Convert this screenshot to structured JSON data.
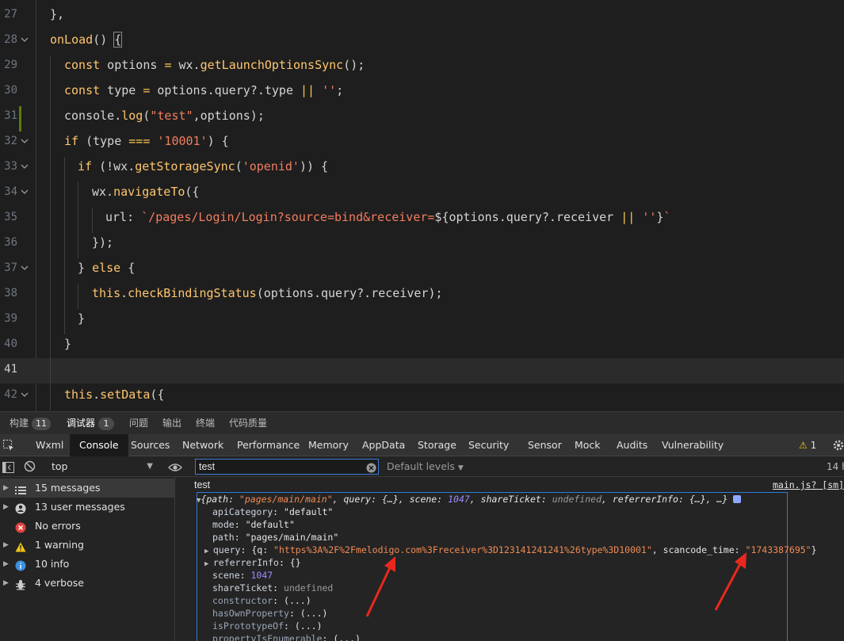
{
  "editor": {
    "lines": [
      {
        "num": "27",
        "fold": false,
        "tokens": [
          {
            "t": "},",
            "c": "pl"
          }
        ]
      },
      {
        "num": "28",
        "fold": true,
        "tokens": [
          {
            "t": "onLoad",
            "c": "fn"
          },
          {
            "t": "() ",
            "c": "pl"
          },
          {
            "t": "{",
            "c": "pl"
          }
        ]
      },
      {
        "num": "29",
        "fold": false,
        "tokens": [
          {
            "t": "const",
            "c": "kw"
          },
          {
            "t": " options ",
            "c": "pl"
          },
          {
            "t": "=",
            "c": "op"
          },
          {
            "t": " wx.",
            "c": "pl"
          },
          {
            "t": "getLaunchOptionsSync",
            "c": "fn"
          },
          {
            "t": "();",
            "c": "pl"
          }
        ]
      },
      {
        "num": "30",
        "fold": false,
        "tokens": [
          {
            "t": "const",
            "c": "kw"
          },
          {
            "t": " type ",
            "c": "pl"
          },
          {
            "t": "=",
            "c": "op"
          },
          {
            "t": " options.query?.type ",
            "c": "pl"
          },
          {
            "t": "||",
            "c": "op"
          },
          {
            "t": " ",
            "c": "pl"
          },
          {
            "t": "''",
            "c": "str"
          },
          {
            "t": ";",
            "c": "pl"
          }
        ]
      },
      {
        "num": "31",
        "fold": false,
        "tokens": [
          {
            "t": "console.",
            "c": "pl"
          },
          {
            "t": "log",
            "c": "fn"
          },
          {
            "t": "(",
            "c": "pl"
          },
          {
            "t": "\"test\"",
            "c": "str"
          },
          {
            "t": ",options);",
            "c": "pl"
          }
        ]
      },
      {
        "num": "32",
        "fold": true,
        "tokens": [
          {
            "t": "if",
            "c": "kw"
          },
          {
            "t": " (type ",
            "c": "pl"
          },
          {
            "t": "===",
            "c": "op"
          },
          {
            "t": " ",
            "c": "pl"
          },
          {
            "t": "'10001'",
            "c": "str"
          },
          {
            "t": ") {",
            "c": "pl"
          }
        ]
      },
      {
        "num": "33",
        "fold": true,
        "tokens": [
          {
            "t": "if",
            "c": "kw"
          },
          {
            "t": " (!wx.",
            "c": "pl"
          },
          {
            "t": "getStorageSync",
            "c": "fn"
          },
          {
            "t": "(",
            "c": "pl"
          },
          {
            "t": "'openid'",
            "c": "str"
          },
          {
            "t": ")) {",
            "c": "pl"
          }
        ]
      },
      {
        "num": "34",
        "fold": true,
        "tokens": [
          {
            "t": "wx.",
            "c": "pl"
          },
          {
            "t": "navigateTo",
            "c": "fn"
          },
          {
            "t": "({",
            "c": "pl"
          }
        ]
      },
      {
        "num": "35",
        "fold": false,
        "tokens": [
          {
            "t": "url: ",
            "c": "pl"
          },
          {
            "t": "`/pages/Login/Login?source=bind&receiver=",
            "c": "str"
          },
          {
            "t": "${options.query?.receiver ",
            "c": "pl"
          },
          {
            "t": "||",
            "c": "op"
          },
          {
            "t": " ",
            "c": "pl"
          },
          {
            "t": "''",
            "c": "str"
          },
          {
            "t": "}",
            "c": "pl"
          },
          {
            "t": "`",
            "c": "str"
          }
        ]
      },
      {
        "num": "36",
        "fold": false,
        "tokens": [
          {
            "t": "});",
            "c": "pl"
          }
        ]
      },
      {
        "num": "37",
        "fold": true,
        "tokens": [
          {
            "t": "} ",
            "c": "pl"
          },
          {
            "t": "else",
            "c": "kw"
          },
          {
            "t": " {",
            "c": "pl"
          }
        ]
      },
      {
        "num": "38",
        "fold": false,
        "tokens": [
          {
            "t": "this",
            "c": "kw"
          },
          {
            "t": ".",
            "c": "pl"
          },
          {
            "t": "checkBindingStatus",
            "c": "fn"
          },
          {
            "t": "(options.query?.receiver);",
            "c": "pl"
          }
        ]
      },
      {
        "num": "39",
        "fold": false,
        "tokens": [
          {
            "t": "}",
            "c": "pl"
          }
        ]
      },
      {
        "num": "40",
        "fold": false,
        "tokens": [
          {
            "t": "}",
            "c": "pl"
          }
        ]
      },
      {
        "num": "41",
        "fold": false,
        "tokens": []
      },
      {
        "num": "42",
        "fold": true,
        "tokens": [
          {
            "t": "this",
            "c": "kw"
          },
          {
            "t": ".",
            "c": "pl"
          },
          {
            "t": "setData",
            "c": "fn"
          },
          {
            "t": "({",
            "c": "pl"
          }
        ]
      }
    ]
  },
  "panel_tabs": {
    "build_label": "构建",
    "build_count": "11",
    "debugger_label": "调试器",
    "debugger_count": "1",
    "problems_label": "问题",
    "output_label": "输出",
    "terminal_label": "终端",
    "code_quality_label": "代码质量"
  },
  "tool_tabs": {
    "items": [
      "Wxml",
      "Console",
      "Sources",
      "Network",
      "Performance",
      "Memory",
      "AppData",
      "Storage",
      "Security",
      "Sensor",
      "Mock",
      "Audits",
      "Vulnerability"
    ],
    "warning_count": "1"
  },
  "console_toolbar": {
    "context": "top",
    "filter_value": "test",
    "levels": "Default levels",
    "hidden_count": "14 h"
  },
  "sidebar": {
    "items": [
      {
        "label": "15 messages",
        "icon": "list-icon"
      },
      {
        "label": "13 user messages",
        "icon": "user-icon"
      },
      {
        "label": "No errors",
        "icon": "error-icon"
      },
      {
        "label": "1 warning",
        "icon": "warning-icon"
      },
      {
        "label": "10 info",
        "icon": "info-icon"
      },
      {
        "label": "4 verbose",
        "icon": "bug-icon"
      }
    ]
  },
  "console": {
    "log_text": "test",
    "source_link": "main.js? [sm]",
    "summary": {
      "path_key": "path",
      "path_val": "\"pages/main/main\"",
      "query_key": "query",
      "query_val": "{…}",
      "scene_key": "scene",
      "scene_val": "1047",
      "shareTicket_key": "shareTicket",
      "shareTicket_val": "undefined",
      "referrerInfo_key": "referrerInfo",
      "referrerInfo_val": "{…}",
      "rest": "…"
    },
    "props": {
      "apiCategory_key": "apiCategory",
      "apiCategory_val": "\"default\"",
      "mode_key": "mode",
      "mode_val": "\"default\"",
      "path_key": "path",
      "path_val": "\"pages/main/main\"",
      "query_key": "query",
      "query_q_key": "q",
      "query_q_val": "\"https%3A%2F%2Fmelodigo.com%3Freceiver%3D123141241241%26type%3D10001\"",
      "query_scan_key": "scancode_time",
      "query_scan_val": "\"1743387695\"",
      "referrerInfo_key": "referrerInfo",
      "referrerInfo_val": "{}",
      "scene_key": "scene",
      "scene_val": "1047",
      "shareTicket_key": "shareTicket",
      "shareTicket_val": "undefined",
      "constructor_key": "constructor",
      "constructor_val": "(...)",
      "hasOwnProperty_key": "hasOwnProperty",
      "hasOwnProperty_val": "(...)",
      "isPrototypeOf_key": "isPrototypeOf",
      "isPrototypeOf_val": "(...)",
      "propertyIsEnumerable_key": "propertyIsEnumerable",
      "propertyIsEnumerable_val": "(...)"
    }
  },
  "colors": {
    "accent": "#2f7bd8",
    "annotation_arrow": "#e8281e"
  }
}
